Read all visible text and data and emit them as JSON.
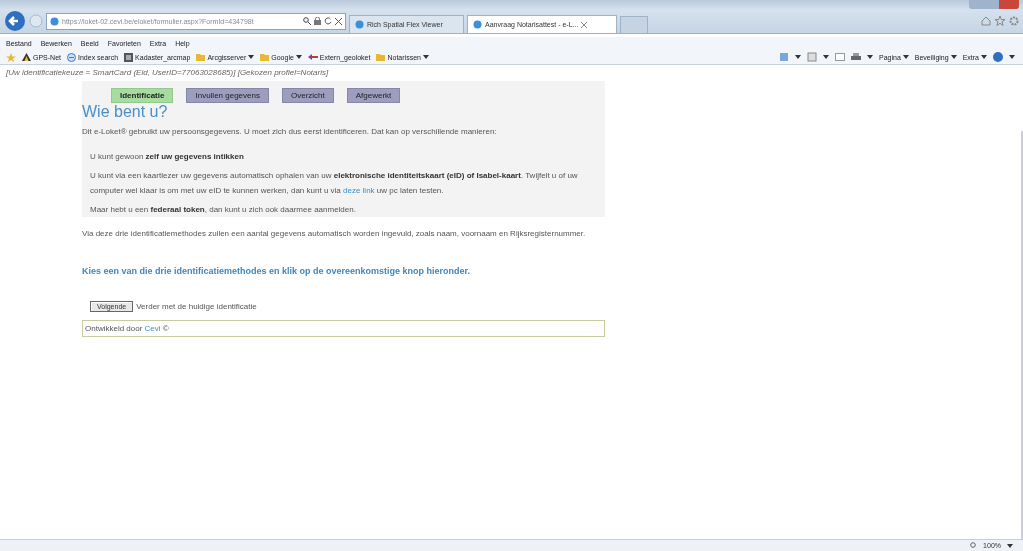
{
  "browser": {
    "address": "https://loket-02.cevi.be/eloket/formulier.aspx?FormId=434798t",
    "tabs": [
      {
        "title": "Rich Spatial Flex Viewer",
        "selected": false
      },
      {
        "title": "Aanvraag Notarisattest - e-L...",
        "selected": true
      }
    ],
    "menu": [
      "Bestand",
      "Bewerken",
      "Beeld",
      "Favorieten",
      "Extra",
      "Help"
    ],
    "favorites": [
      {
        "label": "GPS-Net",
        "kind": "site",
        "dropdown": false
      },
      {
        "label": "Index search",
        "kind": "page",
        "dropdown": false
      },
      {
        "label": "Kadaster_arcmap",
        "kind": "app",
        "dropdown": false
      },
      {
        "label": "Arcgisserver",
        "kind": "folder",
        "dropdown": true
      },
      {
        "label": "Google",
        "kind": "folder",
        "dropdown": true
      },
      {
        "label": "Extern_geoloket",
        "kind": "feed",
        "dropdown": false
      },
      {
        "label": "Notarissen",
        "kind": "folder",
        "dropdown": true
      }
    ],
    "commands": [
      "Pagina",
      "Beveiliging",
      "Extra"
    ],
    "zoom": "100%"
  },
  "page": {
    "identification_info": "[Uw identificatiekeuze = SmartCard (Eid, UserID=77063028685)] [Gekozen profiel=Notaris]",
    "steps": [
      {
        "label": "Identificatie",
        "selected": true
      },
      {
        "label": "Invullen gegevens",
        "selected": false
      },
      {
        "label": "Overzicht",
        "selected": false
      },
      {
        "label": "Afgewerkt",
        "selected": false
      }
    ],
    "heading": "Wie bent u?",
    "intro": "Dit e-Loket® gebruikt uw persoonsgegevens. U moet zich dus eerst identificeren. Dat kan op verschillende manieren:",
    "options": [
      {
        "parts": [
          {
            "kind": "text",
            "text": "U kunt gewoon **zelf uw gegevens intikken**"
          }
        ]
      },
      {
        "parts": [
          {
            "kind": "text",
            "text": "U kunt via een kaartlezer uw gegevens automatisch ophalen van uw **elektronische identiteitskaart (eID) of Isabel-kaart**. Twijfelt u of uw computer wel klaar is om met uw eID te kunnen werken, dan kunt u via "
          },
          {
            "kind": "link",
            "text": "deze link"
          },
          {
            "kind": "text",
            "text": " uw pc laten testen."
          }
        ]
      },
      {
        "parts": [
          {
            "kind": "text",
            "text": "Maar hebt u een **federaal token**, dan kunt u zich ook daarmee aanmelden."
          }
        ]
      }
    ],
    "info": "Via deze drie identificatiemethodes zullen een aantal gegevens automatisch worden ingevuld, zoals naam, voornaam en Rijksregisternummer.",
    "instruction": "Kies een van die drie identificatiemethodes en klik op de overeenkomstige knop hieronder.",
    "next_button": "Volgende",
    "next_description": "Verder met de huidige identificatie",
    "footer": {
      "text": "Ontwikkeld door ",
      "link": "Cevi",
      "suffix": " ©"
    }
  }
}
